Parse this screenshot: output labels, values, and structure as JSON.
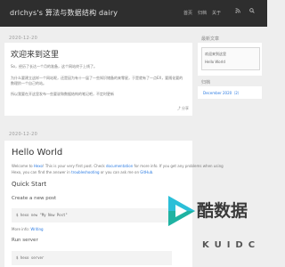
{
  "header": {
    "site_title": "drlchys's 算法与数据结构 dairy",
    "nav": [
      "首页",
      "归档",
      "关于"
    ],
    "icons": [
      "rss-icon",
      "search-icon"
    ]
  },
  "posts": [
    {
      "date": "2020-12-20",
      "title": "欢迎来到这里",
      "paragraphs": [
        "So，经历了长达一个月的准备，这个网站终于上线了。",
        "为什么要建立这样一个网站呢，还是因为有十一届了一些知识储备的来零星，于是就有了一点EX，要随化要的数理阶一个自己的站。",
        "所以我要在开这里发布一些要说和数据结构的笔记吧，不定时更新"
      ],
      "share": "分享"
    },
    {
      "date": "2020-12-20",
      "title": "Hello World",
      "intro_parts": [
        "Welcome to ",
        "Hexo",
        "! This is your very first post. Check ",
        "documentation",
        " for more info. If you get any problems when using"
      ],
      "intro_line2_parts": [
        "Hexo, you can find the answer in ",
        "troubleshooting",
        " or you can ask me on ",
        "GitHub",
        "."
      ],
      "quick_start": "Quick Start",
      "create_post": "Create a new post",
      "create_cmd": "$ hexo new \"My New Post\"",
      "more_info_parts": [
        "More info: ",
        "Writing"
      ],
      "run_server": "Run server",
      "run_cmd": "$ hexo server"
    }
  ],
  "sidebar": {
    "recent_heading": "最新文章",
    "recent_items": [
      "欢迎来到这里",
      "Hello World"
    ],
    "archive_heading": "归档",
    "archive_items": [
      "December 2020（2）"
    ]
  },
  "watermark": {
    "text": "酷数据",
    "sub": "KUIDC",
    "colors": [
      "#2bbfd8",
      "#1fb3a2"
    ]
  }
}
